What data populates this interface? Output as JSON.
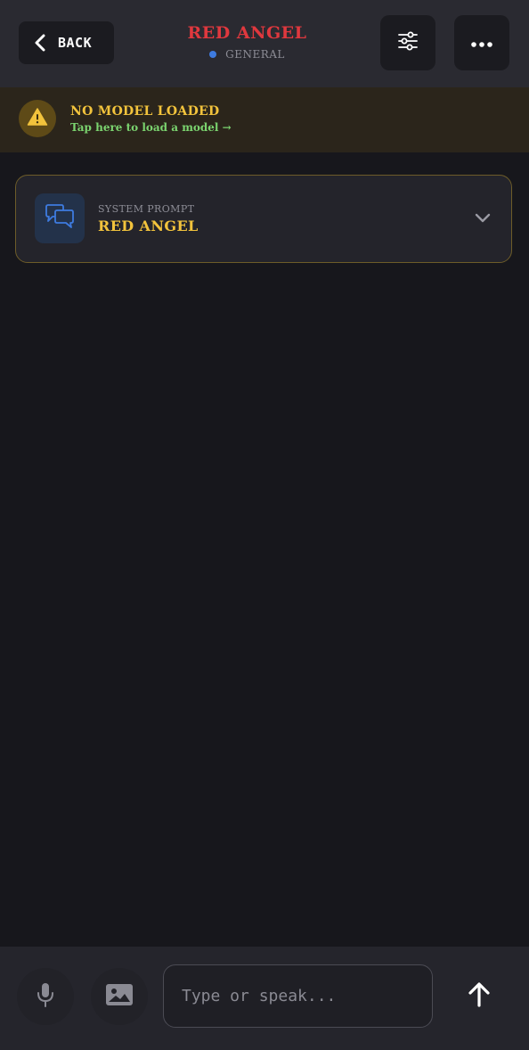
{
  "header": {
    "back_label": "BACK",
    "title": "RED ANGEL",
    "category": "GENERAL",
    "category_dot_color": "#3e7be0",
    "settings_icon": "sliders-icon",
    "more_icon": "more-horizontal-icon"
  },
  "banner": {
    "icon": "warning-icon",
    "title": "NO MODEL LOADED",
    "subtitle": "Tap here to load a model →"
  },
  "system_prompt": {
    "icon": "chat-bubbles-icon",
    "label": "SYSTEM PROMPT",
    "value": "RED ANGEL",
    "expand_icon": "chevron-down-icon"
  },
  "composer": {
    "mic_icon": "microphone-icon",
    "image_icon": "image-icon",
    "placeholder": "Type or speak...",
    "value": "",
    "send_icon": "arrow-up-icon"
  },
  "colors": {
    "accent_red": "#e0383e",
    "accent_yellow": "#f2c33c",
    "link_green": "#7bd46f",
    "background": "#17171c"
  }
}
